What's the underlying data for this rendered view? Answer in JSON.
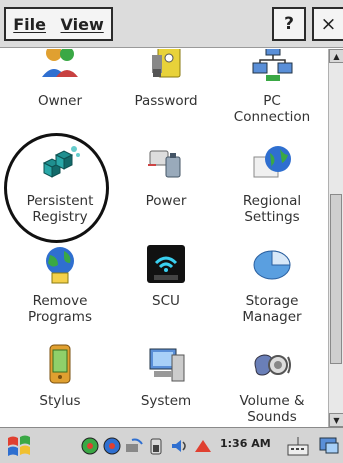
{
  "menu": {
    "file_label": "File",
    "view_label": "View",
    "help_label": "?",
    "close_label": "×"
  },
  "items": [
    {
      "label": "Owner",
      "icon": "owner-icon"
    },
    {
      "label": "Password",
      "icon": "password-icon"
    },
    {
      "label": "PC\nConnection",
      "icon": "pc-connection-icon"
    },
    {
      "label": "Persistent\nRegistry",
      "icon": "persistent-registry-icon"
    },
    {
      "label": "Power",
      "icon": "power-icon"
    },
    {
      "label": "Regional\nSettings",
      "icon": "regional-settings-icon"
    },
    {
      "label": "Remove\nPrograms",
      "icon": "remove-programs-icon"
    },
    {
      "label": "SCU",
      "icon": "scu-icon"
    },
    {
      "label": "Storage\nManager",
      "icon": "storage-manager-icon"
    },
    {
      "label": "Stylus",
      "icon": "stylus-icon"
    },
    {
      "label": "System",
      "icon": "system-icon"
    },
    {
      "label": "Volume &\nSounds",
      "icon": "volume-sounds-icon"
    }
  ],
  "taskbar": {
    "clock": "1:36 AM"
  },
  "colors": {
    "bar": "#dcdcdc",
    "teal": "#1f8f8f",
    "blue": "#2f6fd0",
    "green": "#3aa845"
  }
}
